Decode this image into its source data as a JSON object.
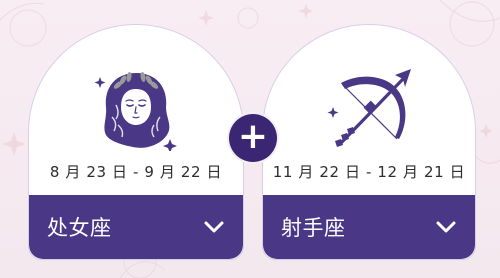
{
  "page": {
    "colors": {
      "background": "#f7ecf1",
      "card_bg": "#ffffff",
      "card_border": "#d8cfe6",
      "accent": "#4a3886",
      "plus_bg": "#3a2673",
      "text_dark": "#2d2d2d"
    }
  },
  "left_card": {
    "icon_name": "virgo-icon",
    "date_range": "8 月 23 日 - 9 月 22 日",
    "sign_label": "处女座",
    "dropdown_icon": "chevron-down-icon"
  },
  "right_card": {
    "icon_name": "sagittarius-icon",
    "date_range": "11 月 22 日 - 12 月 21 日",
    "sign_label": "射手座",
    "dropdown_icon": "chevron-down-icon"
  },
  "plus": {
    "icon_name": "plus-icon",
    "label": "+"
  }
}
